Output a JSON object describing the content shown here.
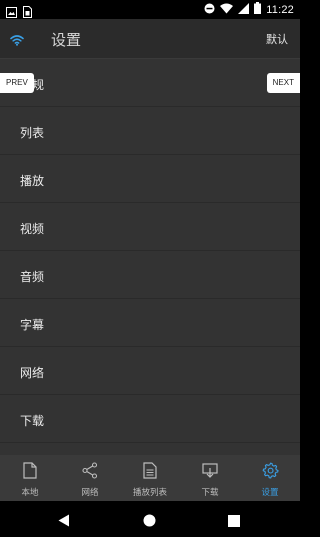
{
  "status_bar": {
    "time": "11:22",
    "left_icons": [
      "image-icon",
      "sim-card-icon"
    ],
    "right_icons": [
      "do-not-disturb-icon",
      "wifi-icon",
      "signal-icon",
      "battery-icon"
    ]
  },
  "header": {
    "title": "设置",
    "default_label": "默认",
    "icon": "wifi-icon",
    "accent_color": "#3aa0e6"
  },
  "overlay": {
    "prev_label": "PREV",
    "next_label": "NEXT"
  },
  "settings_list": {
    "items": [
      {
        "label": "常规"
      },
      {
        "label": "列表"
      },
      {
        "label": "播放"
      },
      {
        "label": "视频"
      },
      {
        "label": "音频"
      },
      {
        "label": "字幕"
      },
      {
        "label": "网络"
      },
      {
        "label": "下载"
      }
    ]
  },
  "bottom_tabs": {
    "items": [
      {
        "label": "本地",
        "icon": "file-icon",
        "active": false
      },
      {
        "label": "网络",
        "icon": "share-icon",
        "active": false
      },
      {
        "label": "播放列表",
        "icon": "playlist-icon",
        "active": false
      },
      {
        "label": "下载",
        "icon": "download-icon",
        "active": false
      },
      {
        "label": "设置",
        "icon": "gear-icon",
        "active": true
      }
    ],
    "active_color": "#3aa0e6"
  },
  "nav_bar": {
    "icons": [
      "back-icon",
      "home-icon",
      "recents-icon"
    ]
  }
}
